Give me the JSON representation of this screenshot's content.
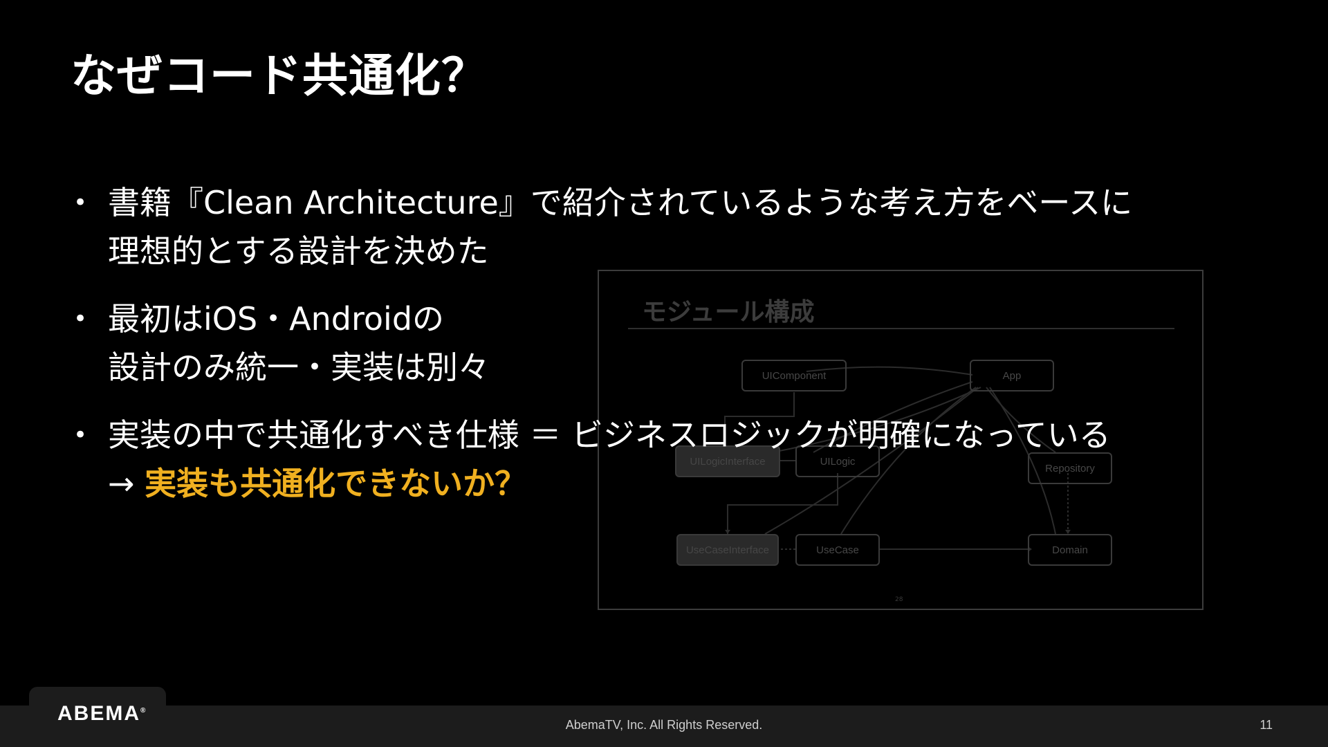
{
  "slide": {
    "title": "なぜコード共通化？",
    "bullet_marker": "•",
    "bullets": [
      {
        "lines": [
          "書籍『Clean Architecture』で紹介されているような考え方をベースに",
          "理想的とする設計を決めた"
        ]
      },
      {
        "lines": [
          "最初はiOS・Androidの",
          "設計のみ統一・実装は別々"
        ]
      },
      {
        "lines": [
          "実装の中で共通化すべき仕様 ＝ ビジネスロジックが明確になっている"
        ],
        "arrow": "→ ",
        "highlight": "実装も共通化できないか？"
      }
    ],
    "highlight_color": "#f0b020"
  },
  "diagram": {
    "title": "モジュール構成",
    "page_number": "28",
    "nodes": {
      "uicomponent": "UIComponent",
      "app": "App",
      "uilogicinterface": "UILogicInterface",
      "uilogic": "UILogic",
      "repository": "Repository",
      "usecaseinterface": "UseCaseInterface",
      "usecase": "UseCase",
      "domain": "Domain"
    }
  },
  "footer": {
    "logo": "ABEMA",
    "logo_mark": "®",
    "copyright": "AbemaTV, Inc. All Rights Reserved.",
    "page_number": "11"
  }
}
